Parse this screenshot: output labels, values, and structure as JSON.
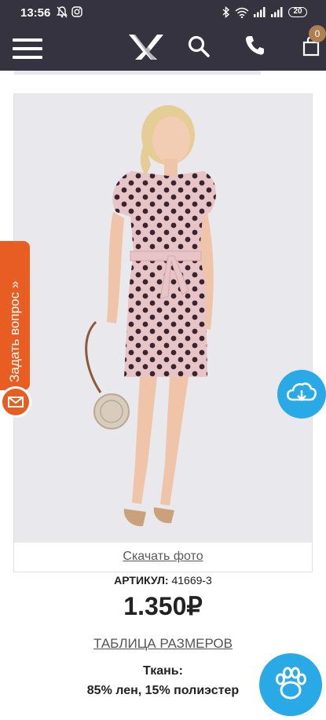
{
  "status_bar": {
    "time": "13:56",
    "battery": "20"
  },
  "header": {
    "cart_count": "0"
  },
  "product": {
    "download_photo": "Скачать фото",
    "sku_label": "АРТИКУЛ:",
    "sku_value": "41669-3",
    "price": "1.350₽",
    "size_table": "ТАБЛИЦА РАЗМЕРОВ",
    "fabric_label": "Ткань:",
    "fabric_value": "85% лен, 15% полиэстер"
  },
  "ask_question": {
    "label": "Задать вопрос »"
  },
  "colors": {
    "header_bg": "#34333f",
    "accent_orange": "#e85d22",
    "accent_blue": "#29a9e6",
    "cart_badge": "#b07e4f",
    "dress_pink": "#e7c4c6",
    "dot_color": "#3a2430"
  },
  "icons": [
    "menu-icon",
    "logo",
    "search-icon",
    "phone-icon",
    "cart-icon",
    "cloud-download-icon",
    "mail-icon",
    "paw-icon"
  ]
}
